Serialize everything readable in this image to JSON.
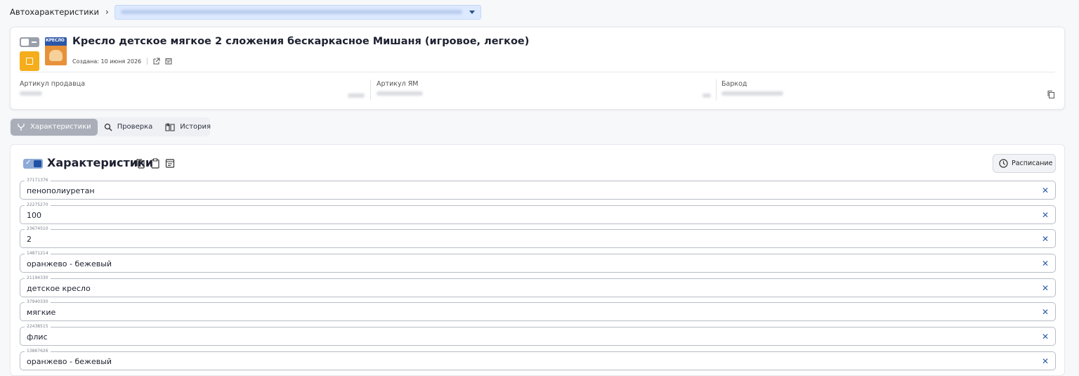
{
  "breadcrumb": {
    "root": "Автохарактеристики",
    "chevron": "›"
  },
  "product": {
    "title": "Кресло детское мягкое 2 сложения бескаркасное Мишаня (игровое, легкое)",
    "thumb_label": "КРЕСЛО",
    "created": "Создана: 10 июня 2026"
  },
  "fields": {
    "seller_article": "Артикул продавца",
    "ym_article": "Артикул ЯМ",
    "barcode": "Баркод"
  },
  "tabs": [
    {
      "label": "Характеристики",
      "active": true,
      "icon": "fork-icon"
    },
    {
      "label": "Проверка",
      "active": false,
      "icon": "search-icon"
    },
    {
      "label": "История",
      "active": false,
      "icon": "book-icon"
    }
  ],
  "section": {
    "title": "Характеристики",
    "schedule_label": "Расписание"
  },
  "rows": [
    {
      "code": "37171376",
      "value": "пенополиуретан"
    },
    {
      "code": "22275270",
      "value": "100"
    },
    {
      "code": "23674510",
      "value": "2"
    },
    {
      "code": "14871214",
      "value": "оранжево - бежевый"
    },
    {
      "code": "21194330",
      "value": "детское кресло"
    },
    {
      "code": "37940330",
      "value": "мягкие"
    },
    {
      "code": "22438515",
      "value": "флис"
    },
    {
      "code": "13867626",
      "value": "оранжево - бежевый"
    }
  ],
  "colors": {
    "accent": "#2d5cab",
    "status": "#f5ad1c",
    "breadcrumb_select": "#dde9ff"
  }
}
